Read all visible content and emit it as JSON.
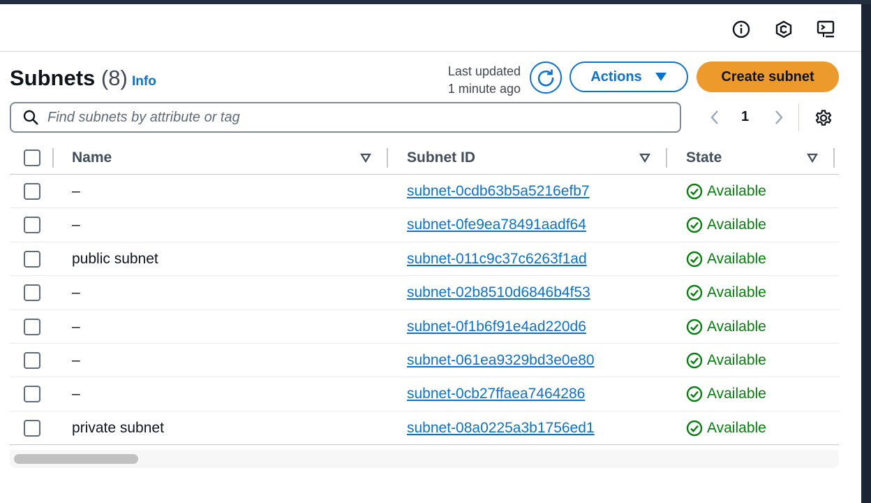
{
  "tools": {
    "info_icon": "info-icon",
    "notifications_icon": "hexagon-icon",
    "cloudshell_icon": "terminal-icon"
  },
  "header": {
    "title": "Subnets",
    "count": "(8)",
    "info_link": "Info",
    "last_updated_line1": "Last updated",
    "last_updated_line2": "1 minute ago",
    "actions_label": "Actions",
    "create_label": "Create subnet"
  },
  "search": {
    "placeholder": "Find subnets by attribute or tag"
  },
  "pagination": {
    "current_page": "1"
  },
  "table": {
    "columns": [
      "Name",
      "Subnet ID",
      "State"
    ],
    "rows": [
      {
        "name": "–",
        "subnet_id": "subnet-0cdb63b5a5216efb7",
        "state": "Available"
      },
      {
        "name": "–",
        "subnet_id": "subnet-0fe9ea78491aadf64",
        "state": "Available"
      },
      {
        "name": "public subnet",
        "subnet_id": "subnet-011c9c37c6263f1ad",
        "state": "Available"
      },
      {
        "name": "–",
        "subnet_id": "subnet-02b8510d6846b4f53",
        "state": "Available"
      },
      {
        "name": "–",
        "subnet_id": "subnet-0f1b6f91e4ad220d6",
        "state": "Available"
      },
      {
        "name": "–",
        "subnet_id": "subnet-061ea9329bd3e0e80",
        "state": "Available"
      },
      {
        "name": "–",
        "subnet_id": "subnet-0cb27ffaea7464286",
        "state": "Available"
      },
      {
        "name": "private subnet",
        "subnet_id": "subnet-08a0225a3b1756ed1",
        "state": "Available"
      }
    ]
  },
  "colors": {
    "link": "#0972d3",
    "primary_button": "#ec9a2c",
    "available": "#037f0c"
  }
}
